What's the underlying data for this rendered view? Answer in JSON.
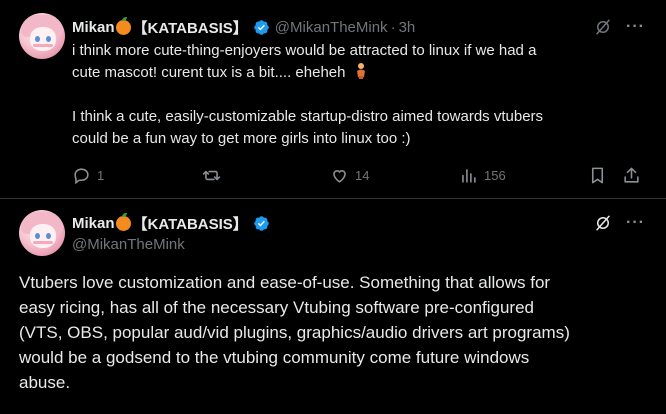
{
  "tweet1": {
    "name": "Mikan",
    "tag": "【KATABASIS】",
    "handle": "@MikanTheMink",
    "separator": "·",
    "time": "3h",
    "line1": "i think more cute-thing-enjoyers would be attracted to linux if we had a",
    "line2": "cute mascot! curent tux is a bit.... eheheh",
    "line3": "I think a cute, easily-customizable startup-distro aimed towards vtubers",
    "line4": "could be a fun way to get more girls into linux too :)",
    "actions": {
      "replies": "1",
      "likes": "14",
      "views": "156"
    }
  },
  "tweet2": {
    "name": "Mikan",
    "tag": "【KATABASIS】",
    "handle": "@MikanTheMink",
    "line1": "Vtubers love customization and ease-of-use. Something that allows for",
    "line2": "easy ricing, has all of the necessary Vtubing software pre-configured",
    "line3": "(VTS, OBS, popular aud/vid plugins, graphics/audio drivers art programs)",
    "line4": "would be a godsend to the vtubing community come future windows",
    "line5": "abuse."
  },
  "icons": {
    "more": "···",
    "accent": "#1d9bf0",
    "muted": "#71767b"
  }
}
